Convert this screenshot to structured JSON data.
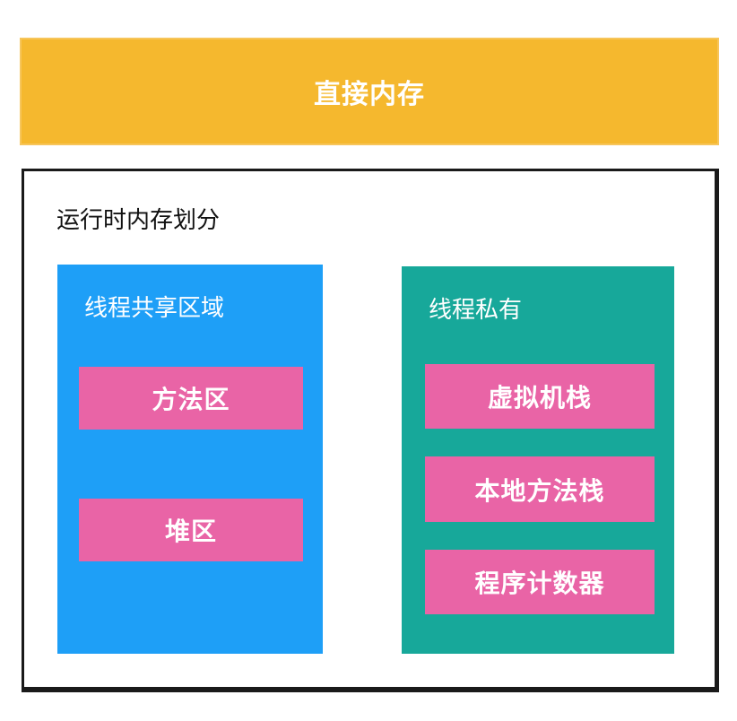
{
  "direct_memory": {
    "label": "直接内存"
  },
  "runtime": {
    "title": "运行时内存划分",
    "shared": {
      "title": "线程共享区域",
      "items": [
        {
          "label": "方法区"
        },
        {
          "label": "堆区"
        }
      ]
    },
    "private": {
      "title": "线程私有",
      "items": [
        {
          "label": "虚拟机栈"
        },
        {
          "label": "本地方法栈"
        },
        {
          "label": "程序计数器"
        }
      ]
    }
  },
  "colors": {
    "direct_memory": "#f5b82e",
    "shared_region": "#1e9ff7",
    "private_region": "#17a89a",
    "block": "#e964a6",
    "border": "#1a1a1a"
  }
}
